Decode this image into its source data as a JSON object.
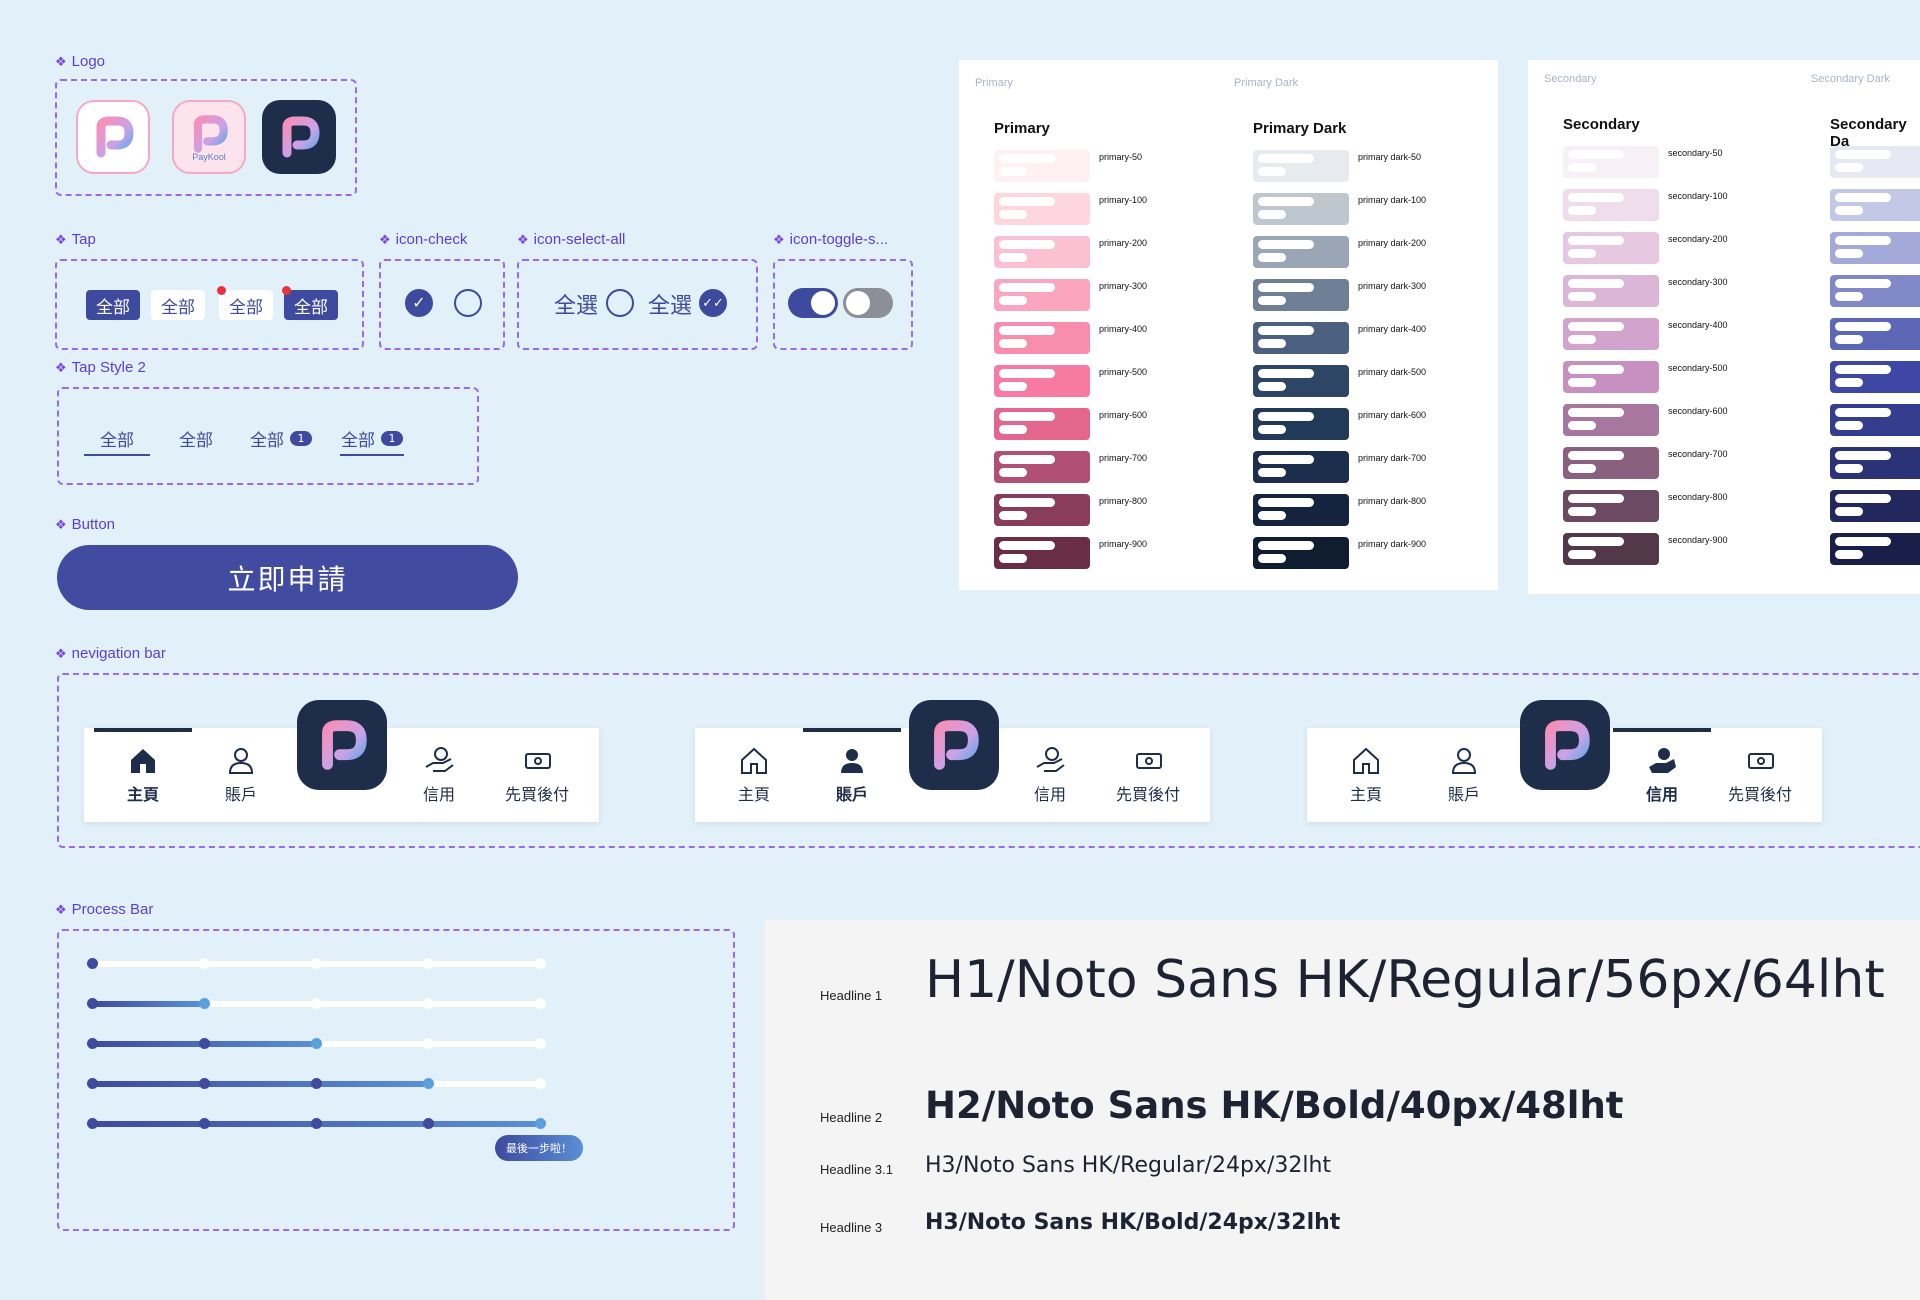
{
  "sections": {
    "logo": "Logo",
    "tap": "Tap",
    "icon_check": "icon-check",
    "icon_select_all": "icon-select-all",
    "icon_toggle": "icon-toggle-s...",
    "tap_style2": "Tap Style 2",
    "button": "Button",
    "navbar": "nevigation bar",
    "process": "Process Bar"
  },
  "logo_caption": "PayKool",
  "tap_chips": [
    "全部",
    "全部",
    "全部",
    "全部"
  ],
  "select_all_label": "全選",
  "tap_style2": {
    "items": [
      "全部",
      "全部",
      "全部",
      "全部"
    ],
    "badge": "1"
  },
  "button_label": "立即申請",
  "nav": {
    "items": [
      "主頁",
      "賬戶",
      "信用",
      "先買後付"
    ]
  },
  "process_tip": "最後一步啦！",
  "palette": {
    "primary": {
      "header": "Primary",
      "title": "Primary",
      "header_dark": "Primary Dark",
      "title_dark": "Primary Dark",
      "names": [
        "primary-50",
        "primary-100",
        "primary-200",
        "primary-300",
        "primary-400",
        "primary-500",
        "primary-600",
        "primary-700",
        "primary-800",
        "primary-900"
      ],
      "dark_names": [
        "primary dark-50",
        "primary dark-100",
        "primary dark-200",
        "primary dark-300",
        "primary dark-400",
        "primary dark-500",
        "primary dark-600",
        "primary dark-700",
        "primary dark-800",
        "primary dark-900"
      ],
      "colors": [
        "#fff0f4",
        "#fdd6e2",
        "#fcc0d3",
        "#fba6c1",
        "#f98db0",
        "#f77aa2",
        "#e2668e",
        "#b24f74",
        "#8a3d5a",
        "#6a2e44"
      ],
      "dark_colors": [
        "#e7eaee",
        "#bec6d0",
        "#9aa6b6",
        "#6e7f96",
        "#4c6180",
        "#2e4666",
        "#22395a",
        "#1b2e4c",
        "#15243e",
        "#101c30"
      ]
    },
    "secondary": {
      "header": "Secondary",
      "title": "Secondary",
      "header_dark": "Secondary Dark",
      "title_dark": "Secondary Da",
      "names": [
        "secondary-50",
        "secondary-100",
        "secondary-200",
        "secondary-300",
        "secondary-400",
        "secondary-500",
        "secondary-600",
        "secondary-700",
        "secondary-800",
        "secondary-900"
      ],
      "colors": [
        "#f8f0f7",
        "#efdcec",
        "#e6c9e1",
        "#dcb6d7",
        "#d2a3cc",
        "#c890c1",
        "#a8779f",
        "#8a607f",
        "#6c4a63",
        "#523849"
      ],
      "dark_colors": [
        "#e6e8f4",
        "#c3c8e6",
        "#a3a9d8",
        "#8088c8",
        "#5d67b8",
        "#3e48a4",
        "#343d8e",
        "#2b3276",
        "#22285e",
        "#1a1f4a"
      ]
    }
  },
  "typography": [
    {
      "label": "Headline 1",
      "sample": "H1/Noto Sans HK/Regular/56px/64lht"
    },
    {
      "label": "Headline 2",
      "sample": "H2/Noto Sans HK/Bold/40px/48lht"
    },
    {
      "label": "Headline 3.1",
      "sample": "H3/Noto Sans HK/Regular/24px/32lht"
    },
    {
      "label": "Headline 3",
      "sample": "H3/Noto Sans HK/Bold/24px/32lht"
    }
  ],
  "colors": {
    "accent": "#3e4a9e",
    "label": "#5c3fd0",
    "dash": "#9a6ae8",
    "navy": "#1e2d4a",
    "badge_red": "#e8323c"
  }
}
